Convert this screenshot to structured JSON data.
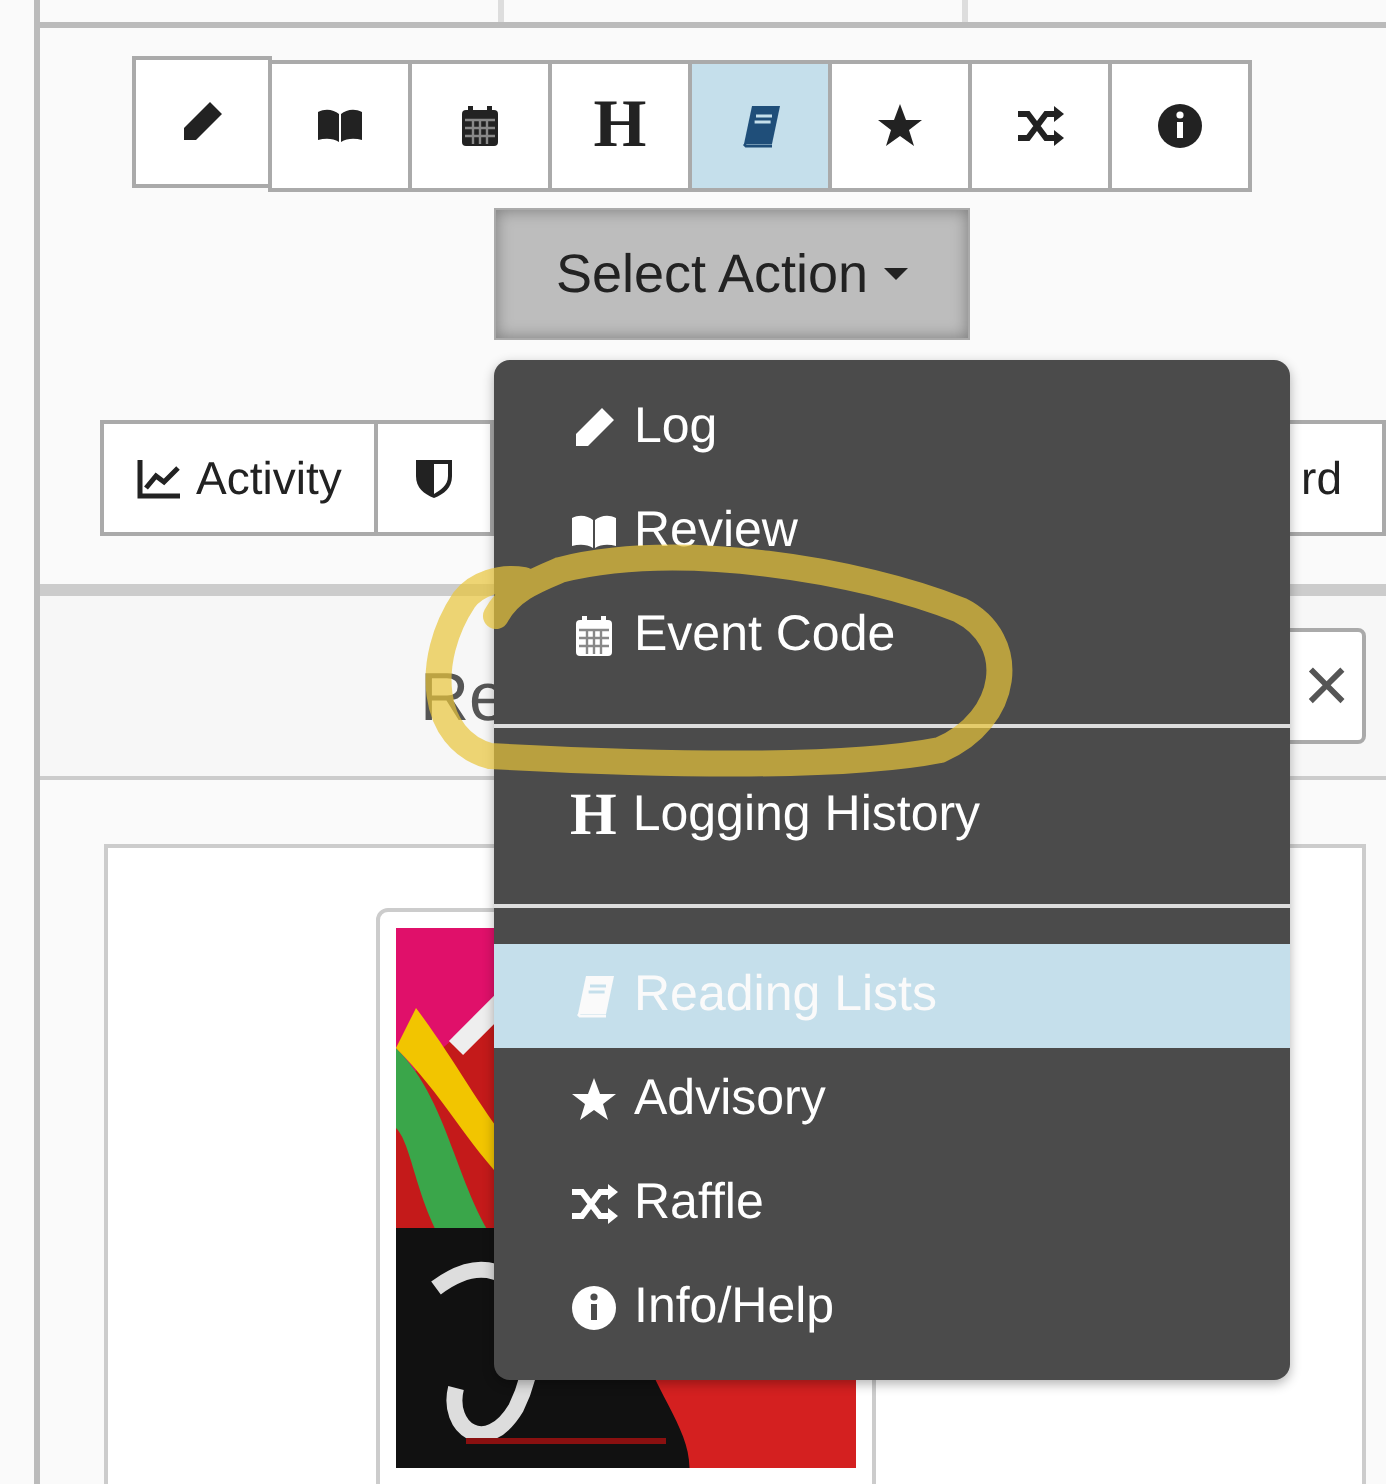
{
  "toolbar": [
    {
      "kind": "log",
      "selected": false
    },
    {
      "kind": "review",
      "selected": false
    },
    {
      "kind": "event",
      "selected": false
    },
    {
      "kind": "history",
      "glyph": "H",
      "selected": false
    },
    {
      "kind": "reading",
      "selected": true
    },
    {
      "kind": "advisory",
      "selected": false
    },
    {
      "kind": "raffle",
      "selected": false
    },
    {
      "kind": "info",
      "selected": false
    }
  ],
  "action_button": {
    "label": "Select Action"
  },
  "secondary_buttons": [
    {
      "kind": "activity",
      "label": "Activity"
    },
    {
      "kind": "shield"
    },
    {
      "kind": "text",
      "label": "rd"
    }
  ],
  "panel": {
    "heading": "Re",
    "close_glyph": "×"
  },
  "menu": {
    "items": [
      {
        "kind": "log",
        "label": "Log",
        "selected": false,
        "divider_after": false
      },
      {
        "kind": "review",
        "label": "Review",
        "selected": false,
        "divider_after": false
      },
      {
        "kind": "event",
        "label": "Event Code",
        "selected": false,
        "divider_after": true
      },
      {
        "kind": "history",
        "glyph": "H",
        "label": "Logging History",
        "selected": false,
        "divider_after": true
      },
      {
        "kind": "reading",
        "label": "Reading Lists",
        "selected": true,
        "divider_after": false
      },
      {
        "kind": "advisory",
        "label": "Advisory",
        "selected": false,
        "divider_after": false
      },
      {
        "kind": "raffle",
        "label": "Raffle",
        "selected": false,
        "divider_after": false
      },
      {
        "kind": "info",
        "label": "Info/Help",
        "selected": false,
        "divider_after": false
      }
    ]
  },
  "annotation": {
    "kind": "scribble"
  }
}
